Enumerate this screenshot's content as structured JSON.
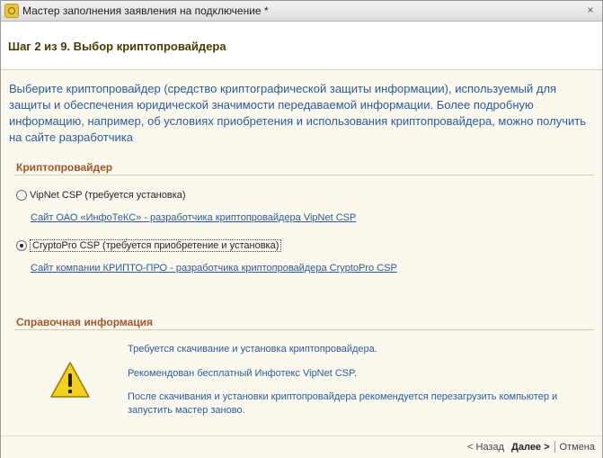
{
  "window": {
    "title": "Мастер заполнения заявления на подключение *",
    "close_glyph": "×"
  },
  "header": {
    "step_title": "Шаг 2 из 9. Выбор криптопровайдера"
  },
  "intro": {
    "text": "Выберите криптопровайдер (средство криптографической защиты информации), используемый для защиты и обеспечения юридической значимости передаваемой информации. Более подробную информацию, например, об условиях приобретения и использования криптопровайдера, можно получить на сайте разработчика"
  },
  "provider_group": {
    "title": "Криптопровайдер",
    "options": [
      {
        "label": "VipNet CSP (требуется установка)",
        "checked": false,
        "link": "Сайт ОАО «ИнфоТеКС» - разработчика криптопровайдера VipNet CSP"
      },
      {
        "label": "CryptoPro CSP (требуется приобретение и установка)",
        "checked": true,
        "link": "Сайт компании КРИПТО-ПРО - разработчика криптопровайдера  CryptoPro CSP"
      }
    ]
  },
  "reference_group": {
    "title": "Справочная информация",
    "lines": [
      "Требуется скачивание и установка криптопровайдера.",
      "Рекомендован бесплатный Инфотекс VipNet CSP.",
      "После скачивания и установки криптопровайдера рекомендуется перезагрузить компьютер и запустить мастер заново."
    ],
    "icon": "warning-icon"
  },
  "footer": {
    "back_label": "< Назад",
    "next_label": "Далее  >",
    "cancel_label": "Отмена"
  },
  "colors": {
    "background": "#fbf9ee",
    "group_title": "#a1562a",
    "link": "#2a5aa0",
    "warning_fill": "#f2d21a"
  }
}
